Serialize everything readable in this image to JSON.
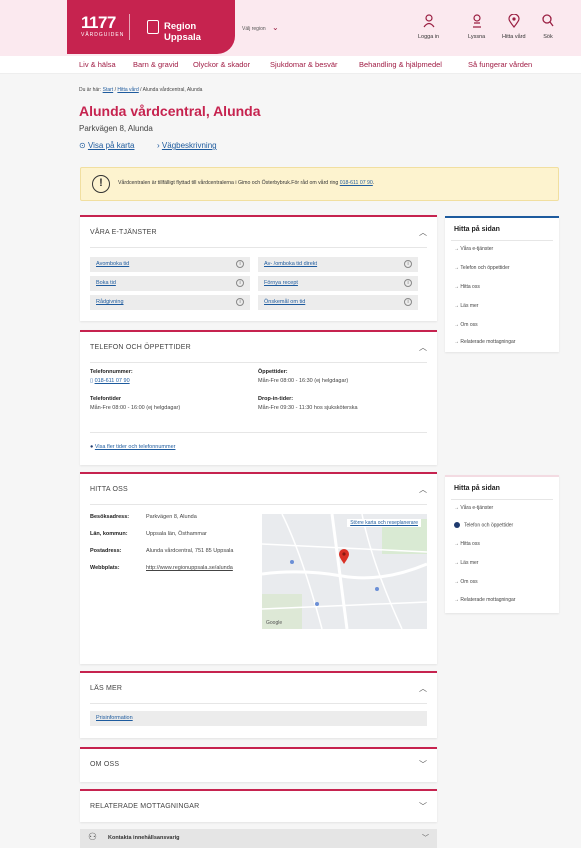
{
  "header": {
    "logo_number": "1177",
    "logo_sub": "VÅRDGUIDEN",
    "region_name": "Region Uppsala",
    "region_select": "Välj region",
    "actions": [
      {
        "label": "Logga in",
        "icon": "person-icon"
      },
      {
        "label": "Lyssna",
        "icon": "listen-icon"
      },
      {
        "label": "Hitta vård",
        "icon": "location-icon"
      },
      {
        "label": "Sök",
        "icon": "search-icon"
      }
    ]
  },
  "nav": {
    "items": [
      "Liv & hälsa",
      "Barn & gravid",
      "Olyckor & skador",
      "Sjukdomar & besvär",
      "Behandling & hjälpmedel",
      "Så fungerar vården"
    ]
  },
  "breadcrumb": {
    "prefix": "Du är här:",
    "items": [
      "Start",
      "Hitta vård",
      "Alunda vårdcentral, Alunda"
    ]
  },
  "page": {
    "title": "Alunda vårdcentral, Alunda",
    "address": "Parkvägen 8, Alunda",
    "map_link": "Visa på karta",
    "route_link": "Vägbeskrivning"
  },
  "notice": {
    "text": "Vårdcentralen är tillfälligt flyttad till vårdcentralerna i Gimo och Österbybruk.För råd om vård ring",
    "phone": "018-611 07 90",
    "tail": "."
  },
  "eservices": {
    "title": "VÅRA E-TJÄNSTER",
    "items": [
      "Avomboka tid",
      "Av- /omboka tid direkt",
      "Boka tid",
      "Förnya recept",
      "Rådgivning",
      "Önskemål om tid"
    ]
  },
  "phone": {
    "title": "TELEFON OCH ÖPPETTIDER",
    "phone_label": "Telefonnummer:",
    "phone_value": "018-611 07 90",
    "open_label": "Öppettider:",
    "open_value": "Mån-Fre  08:00 - 16:30 (ej helgdagar)",
    "phone_hours_label": "Telefontider",
    "phone_hours_value": "Mån-Fre  08:00 - 16:00 (ej helgdagar)",
    "dropin_label": "Drop-in-tider:",
    "dropin_value": "Mån-Fre  09:30 - 11:30 hos sjuksköterska",
    "more_link": "Visa fler tider och telefonnummer"
  },
  "find": {
    "title": "HITTA OSS",
    "visit_label": "Besöksadress:",
    "visit_value": "Parkvägen 8, Alunda",
    "county_label": "Län, kommun:",
    "county_value": "Uppsala län, Östhammar",
    "post_label": "Postadress:",
    "post_value": "Alunda vårdcentral, 751 85 Uppsala",
    "web_label": "Webbplats:",
    "web_value": "http://www.regionuppsala.se/alunda",
    "map_larger": "Större karta och reseplanerare",
    "map_google": "Google"
  },
  "read_more": {
    "title": "LÄS MER",
    "item": "Prisinformation"
  },
  "about": {
    "title": "OM OSS"
  },
  "related": {
    "title": "RELATERADE MOTTAGNINGAR"
  },
  "contact": {
    "label": "Kontakta innehållsansvarig"
  },
  "sidebar": {
    "title": "Hitta på sidan",
    "items": [
      "Våra e-tjänster",
      "Telefon och öppettider",
      "Hitta oss",
      "Läs mer",
      "Om oss",
      "Relaterade mottagningar"
    ]
  },
  "colors": {
    "brand": "#c6234f",
    "accent": "#1e5b9e",
    "notice_bg": "#fdf3cf"
  }
}
